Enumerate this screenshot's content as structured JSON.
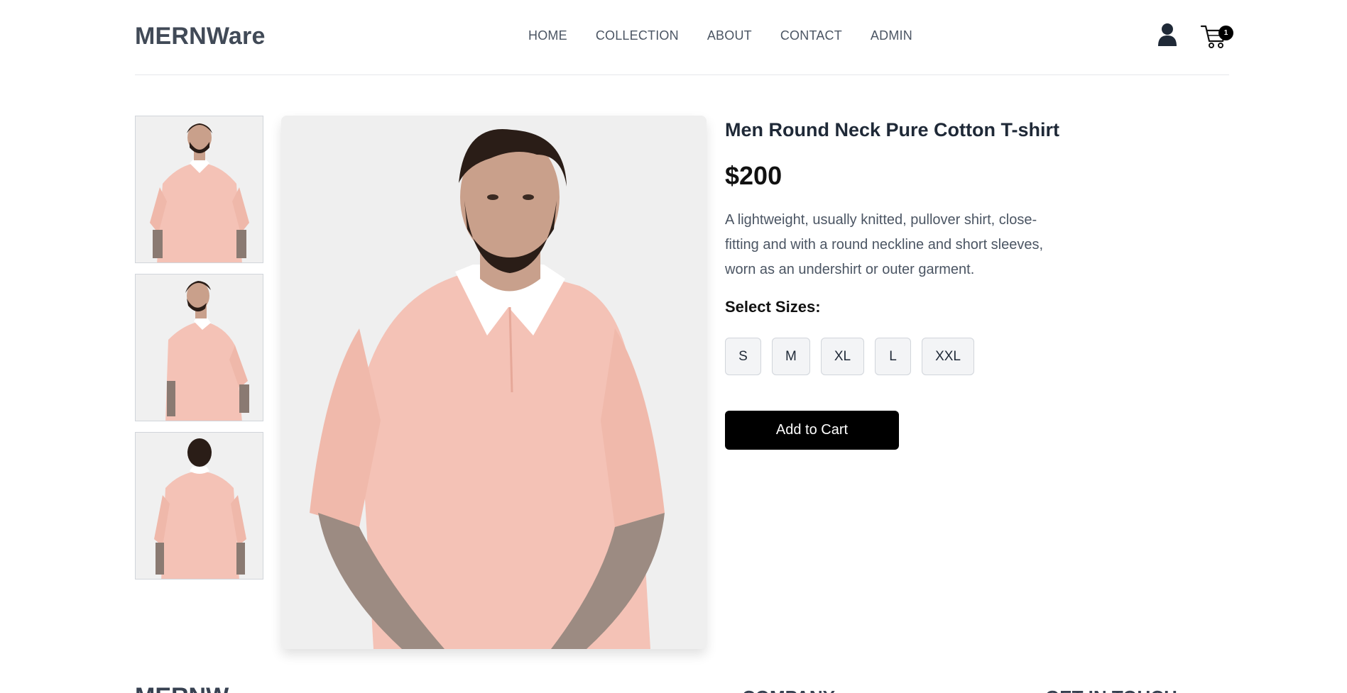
{
  "header": {
    "logo": "MERNWare",
    "nav": [
      "HOME",
      "COLLECTION",
      "ABOUT",
      "CONTACT",
      "ADMIN"
    ],
    "cart_count": "1",
    "icons": [
      "user-icon",
      "cart-icon"
    ]
  },
  "product": {
    "title": "Men Round Neck Pure Cotton T-shirt",
    "price": "$200",
    "description": "A lightweight, usually knitted, pullover shirt, close-fitting and with a round neckline and short sleeves, worn as an undershirt or outer garment.",
    "sizes_label": "Select Sizes:",
    "sizes": [
      "S",
      "M",
      "XL",
      "L",
      "XXL"
    ],
    "add_to_cart": "Add to Cart",
    "colors": {
      "shirt": "#f4c2b6",
      "collar": "#ffffff",
      "background": "#efefef"
    }
  },
  "footer": {
    "logo": "MERNW",
    "company": "COMPANY",
    "get_in_touch": "GET IN TOUCH"
  }
}
